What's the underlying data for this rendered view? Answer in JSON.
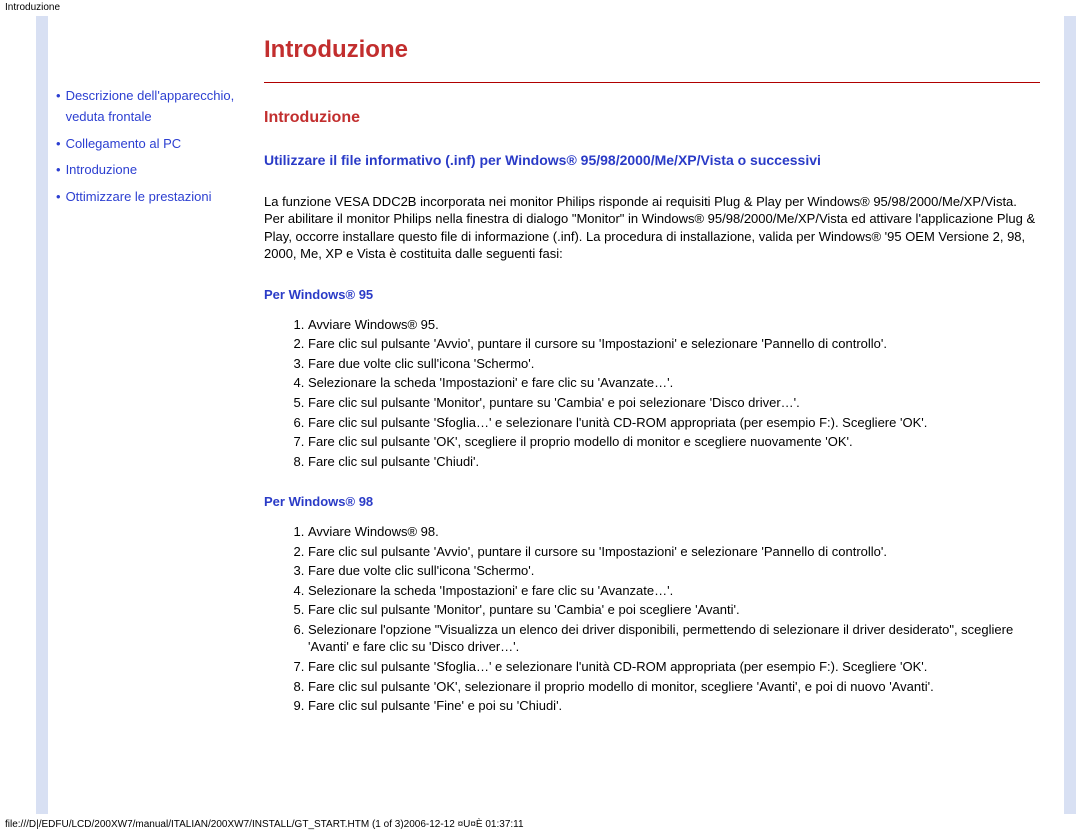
{
  "pageTitleTop": "Introduzione",
  "footerPath": "file:///D|/EDFU/LCD/200XW7/manual/ITALIAN/200XW7/INSTALL/GT_START.HTM (1 of 3)2006-12-12 ¤U¤È 01:37:11",
  "sidebar": {
    "items": [
      {
        "bullet": "•",
        "label": "Descrizione dell'apparecchio, veduta frontale"
      },
      {
        "bullet": "•",
        "label": "Collegamento al PC"
      },
      {
        "bullet": "•",
        "label": "Introduzione"
      },
      {
        "bullet": "•",
        "label": "Ottimizzare le prestazioni"
      }
    ]
  },
  "main": {
    "h1": "Introduzione",
    "h2": "Introduzione",
    "h3": "Utilizzare il file informativo (.inf) per Windows® 95/98/2000/Me/XP/Vista o successivi",
    "intro_para": "La funzione VESA DDC2B incorporata nei monitor Philips risponde ai requisiti Plug & Play per Windows® 95/98/2000/Me/XP/Vista. Per abilitare il monitor Philips nella finestra di dialogo \"Monitor\" in Windows® 95/98/2000/Me/XP/Vista ed attivare l'applicazione Plug & Play, occorre installare questo file di informazione (.inf). La procedura di installazione, valida per Windows® '95 OEM Versione 2, 98, 2000, Me, XP e Vista è costituita dalle seguenti fasi:",
    "sections": [
      {
        "title": "Per Windows® 95",
        "steps": [
          "Avviare Windows® 95.",
          "Fare clic sul pulsante 'Avvio', puntare il cursore su 'Impostazioni' e selezionare 'Pannello di controllo'.",
          "Fare due volte clic sull'icona 'Schermo'.",
          "Selezionare la scheda 'Impostazioni' e fare clic su 'Avanzate…'.",
          "Fare clic sul pulsante 'Monitor', puntare su 'Cambia' e poi selezionare 'Disco driver…'.",
          "Fare clic sul pulsante 'Sfoglia…' e selezionare l'unità CD-ROM appropriata  (per esempio F:). Scegliere 'OK'.",
          "Fare clic sul pulsante 'OK', scegliere il proprio modello di monitor e scegliere nuovamente 'OK'.",
          "Fare clic sul pulsante 'Chiudi'."
        ]
      },
      {
        "title": "Per Windows® 98",
        "steps": [
          "Avviare Windows® 98.",
          "Fare clic sul pulsante 'Avvio', puntare il cursore su 'Impostazioni' e selezionare 'Pannello di controllo'.",
          "Fare due volte clic sull'icona 'Schermo'.",
          "Selezionare la scheda 'Impostazioni' e fare clic su 'Avanzate…'.",
          "Fare clic sul pulsante 'Monitor', puntare su 'Cambia' e poi scegliere 'Avanti'.",
          "Selezionare l'opzione \"Visualizza un elenco dei driver disponibili, permettendo di selezionare il driver desiderato\", scegliere 'Avanti' e fare clic su 'Disco driver…'.",
          "Fare clic sul pulsante 'Sfoglia…' e selezionare l'unità CD-ROM appropriata  (per esempio F:). Scegliere 'OK'.",
          "Fare clic sul pulsante 'OK', selezionare il proprio modello di monitor, scegliere 'Avanti', e poi di nuovo 'Avanti'.",
          "Fare clic sul pulsante 'Fine' e poi su 'Chiudi'."
        ]
      }
    ]
  }
}
